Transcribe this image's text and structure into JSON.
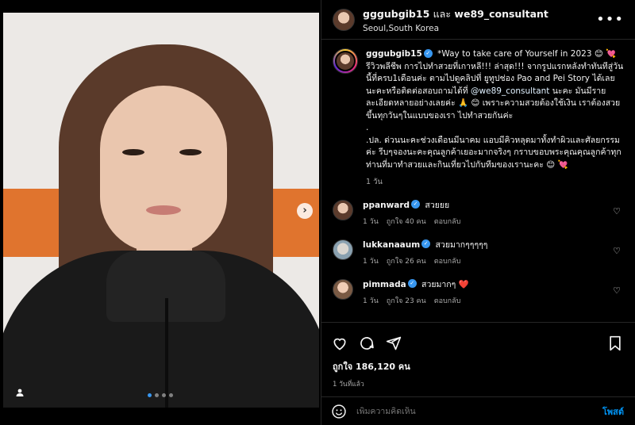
{
  "post": {
    "header": {
      "username": "gggubgib15",
      "and_text": "และ",
      "collaborator": "we89_consultant",
      "location": "Seoul,South Korea"
    },
    "caption": {
      "username": "gggubgib15",
      "text_part1": "*Way to take care of Yourself in 2023 😊 💘 รีวิวพลีชีพ การไปทำสวยที่เกาหลี!!! ล่าสุด!!! จากรูปแรกหลังทำทันทีสู่วันนี้ที่ครบ1เดือนค่ะ ตามไปดูคลิปที่ ยูทูปช่อง Pao and Pei Story ได้เลยนะคะหรือติดต่อสอบถามได้ที่ ",
      "mention": "@we89_consultant",
      "text_part2": " นะคะ มันมีรายละเอียดหลายอย่างเลยค่ะ 🙏 😊 เพราะความสวยต้องใช้เงิน เราต้องสวยขึ้นทุกวันๆในแบบของเรา ไปทำสวยกันค่ะ",
      "dot": ".",
      "text_part3": ".ปล. ด่วนนะคะช่วงเดือนมีนาคม แอบมีคิวหลุดมาทั้งทำผิวและศัลยกรรมค่ะ รีบๆจองนะคะคุณลูกค้าเยอะมากจริงๆ กราบขอบพระคุณคุณลูกค้าทุกท่านที่มาทำสวยและกินเที่ยวไปกับทีมของเรานะคะ 😊 💘",
      "time": "1 วัน"
    },
    "comments": [
      {
        "username": "ppanward",
        "text": "สวยยย",
        "time": "1 วัน",
        "likes": "ถูกใจ 40 คน",
        "reply": "ตอบกลับ"
      },
      {
        "username": "lukkanaaum",
        "text": "สวยมากๆๆๆๆๆ",
        "time": "1 วัน",
        "likes": "ถูกใจ 26 คน",
        "reply": "ตอบกลับ"
      },
      {
        "username": "pimmada",
        "text": "สวยมากๆ ❤️",
        "time": "1 วัน",
        "likes": "ถูกใจ 23 คน",
        "reply": "ตอบกลับ"
      }
    ],
    "likes_text": "ถูกใจ 186,120 คน",
    "posted_ago": "1 วันที่แล้ว",
    "add_comment": {
      "placeholder": "เพิ่มความคิดเห็น",
      "post_label": "โพสต์"
    },
    "carousel": {
      "total": 4,
      "current": 1
    }
  },
  "icons": {
    "more": "more-horizontal-icon",
    "heart": "heart-icon",
    "comment": "comment-icon",
    "share": "share-icon",
    "save": "bookmark-icon",
    "emoji": "emoji-icon",
    "next": "chevron-right-icon",
    "tag": "user-tag-icon",
    "verified": "verified-badge-icon"
  },
  "colors": {
    "background": "#000000",
    "verified": "#3897f0",
    "post_button": "#0095f6",
    "secondary_text": "#a8a8a8"
  }
}
